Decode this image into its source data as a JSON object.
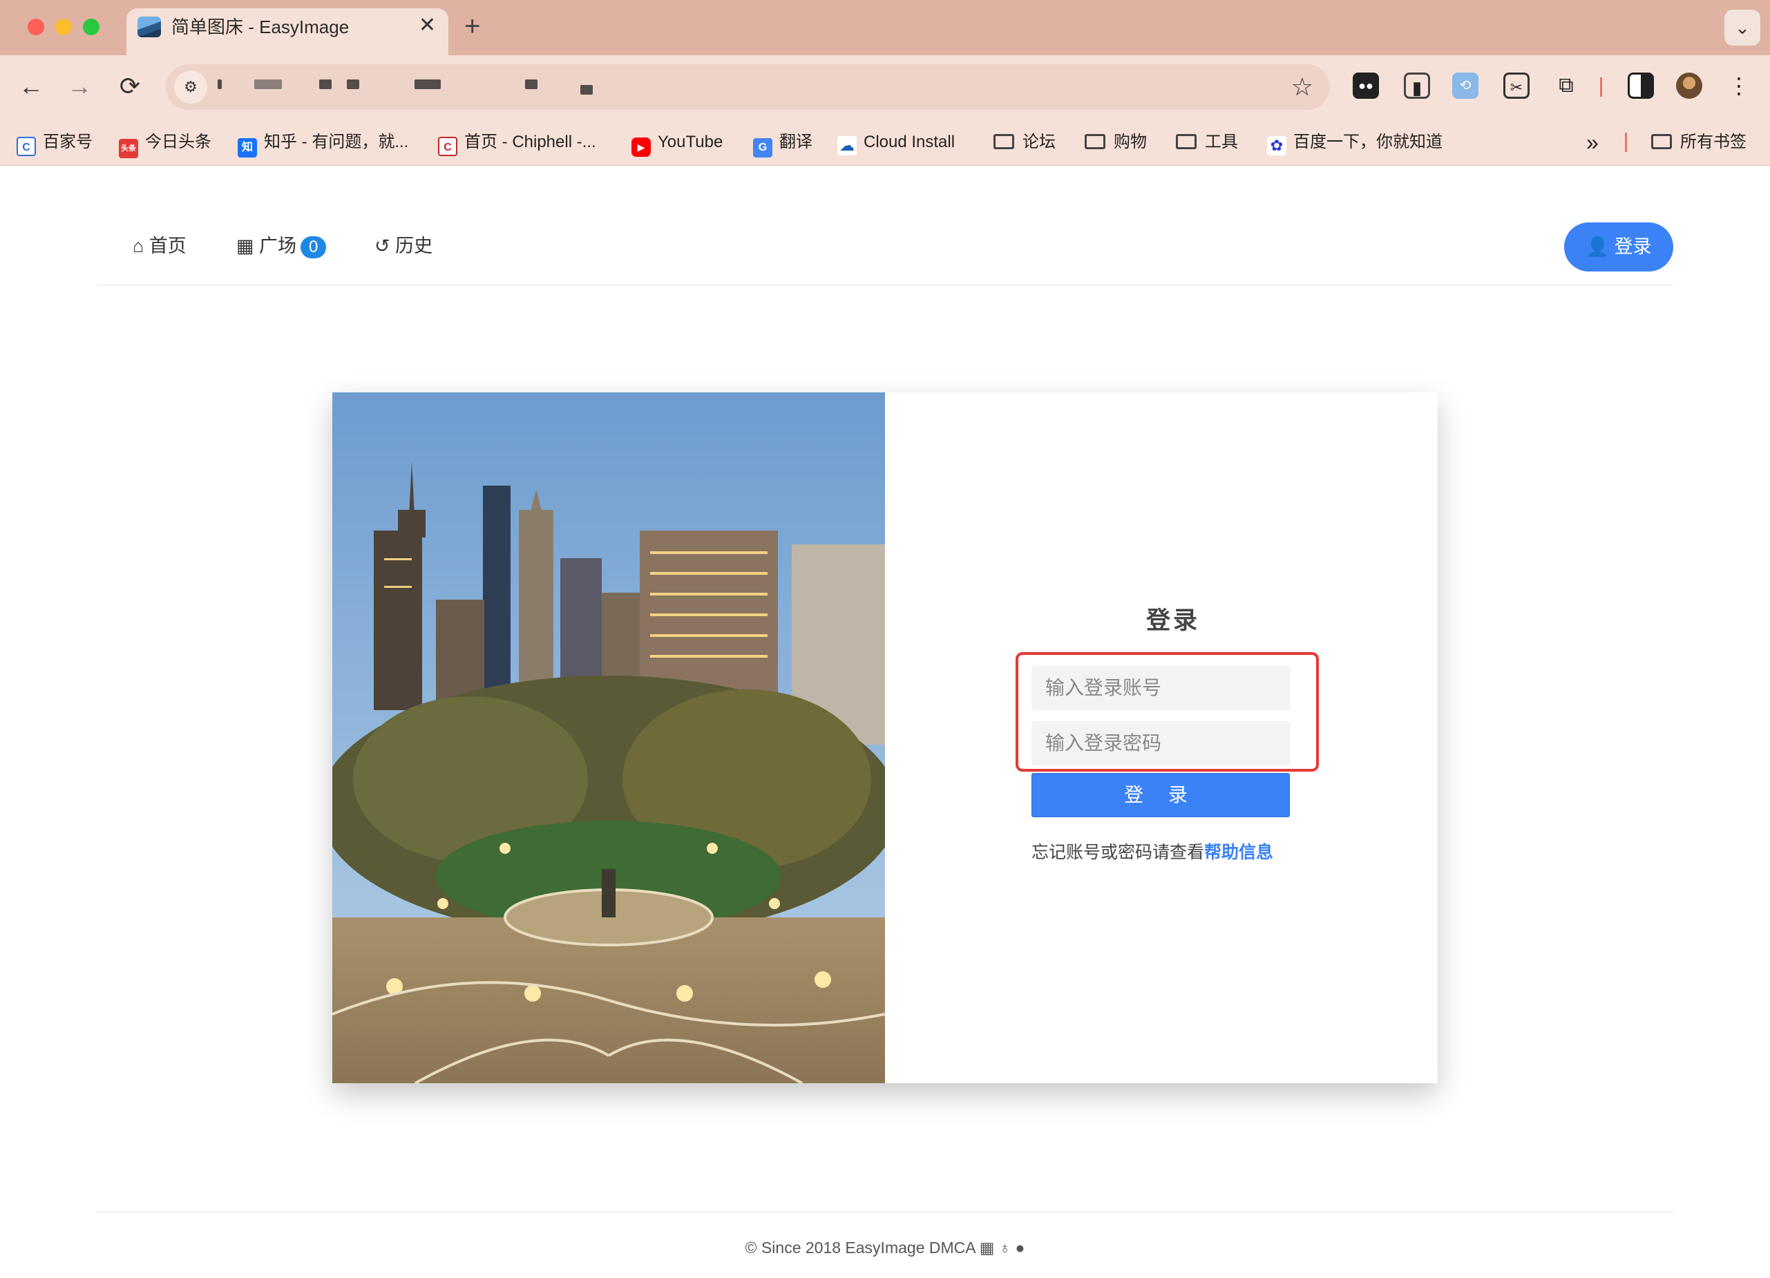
{
  "browser": {
    "tab_title": "简单图床 - EasyImage",
    "tab_close": "✕",
    "new_tab": "+",
    "tab_list": "⌄",
    "accent": "#3b82f6"
  },
  "toolbar": {
    "back": "←",
    "forward": "→",
    "reload": "⟳",
    "bookmark_star": "☆"
  },
  "bookmarks": {
    "items": [
      {
        "label": "百家号",
        "icon": "baijiahao-icon"
      },
      {
        "label": "今日头条",
        "icon": "toutiao-icon"
      },
      {
        "label": "知乎 - 有问题，就...",
        "icon": "zhihu-icon"
      },
      {
        "label": "首页 - Chiphell -...",
        "icon": "chiphell-icon"
      },
      {
        "label": "YouTube",
        "icon": "youtube-icon"
      },
      {
        "label": "翻译",
        "icon": "translate-icon"
      },
      {
        "label": "Cloud Install",
        "icon": "cloud-icon"
      },
      {
        "label": "论坛",
        "icon": "folder-icon"
      },
      {
        "label": "购物",
        "icon": "folder-icon"
      },
      {
        "label": "工具",
        "icon": "folder-icon"
      },
      {
        "label": "百度一下，你就知道",
        "icon": "baidu-icon"
      }
    ],
    "more": "»",
    "all_bookmarks": "所有书签"
  },
  "nav": {
    "home": "首页",
    "square": "广场",
    "square_count": "0",
    "history": "历史",
    "login": "登录"
  },
  "login": {
    "title": "登录",
    "account_placeholder": "输入登录账号",
    "password_placeholder": "输入登录密码",
    "submit": "登 录",
    "help_text": "忘记账号或密码请查看",
    "help_link": "帮助信息"
  },
  "footer": {
    "text": "© Since 2018 EasyImage DMCA"
  }
}
